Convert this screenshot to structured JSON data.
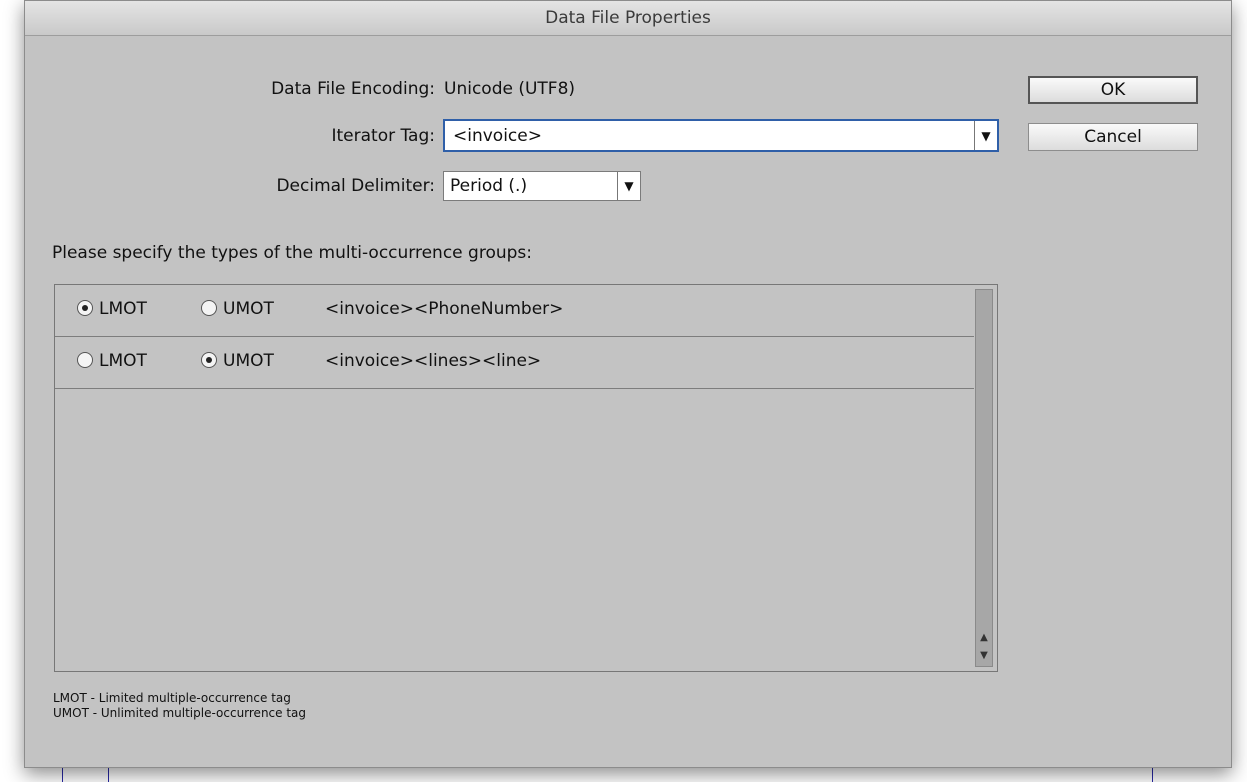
{
  "dialog": {
    "title": "Data File Properties",
    "encoding_label": "Data File Encoding:",
    "encoding_value": "Unicode (UTF8)",
    "iterator_label": "Iterator Tag:",
    "iterator_value": "<invoice>",
    "decimal_label": "Decimal Delimiter:",
    "decimal_value": "Period (.)",
    "ok_label": "OK",
    "cancel_label": "Cancel",
    "groups_prompt": "Please specify the types of the multi-occurrence groups:",
    "groups": [
      {
        "lmot_label": "LMOT",
        "umot_label": "UMOT",
        "selected": "LMOT",
        "path": "<invoice><PhoneNumber>"
      },
      {
        "lmot_label": "LMOT",
        "umot_label": "UMOT",
        "selected": "UMOT",
        "path": "<invoice><lines><line>"
      }
    ],
    "legend_lmot": "LMOT - Limited multiple-occurrence tag",
    "legend_umot": "UMOT - Unlimited multiple-occurrence tag"
  }
}
